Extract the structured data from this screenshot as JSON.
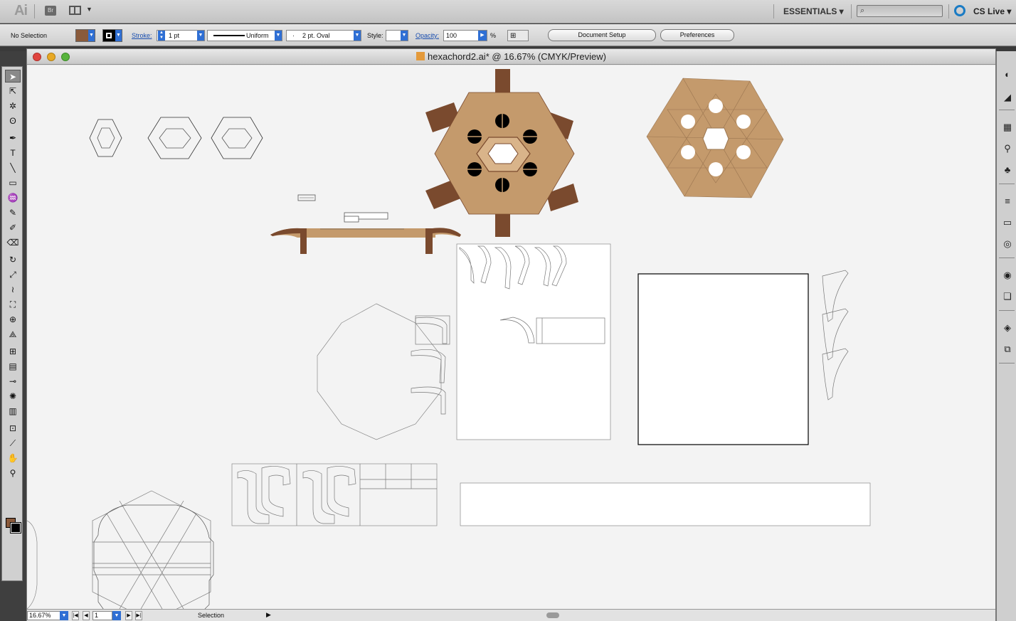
{
  "appbar": {
    "logo": "Ai",
    "bridge": "Br",
    "workspace": "ESSENTIALS ▾",
    "cslive": "CS Live ▾"
  },
  "control": {
    "selection": "No Selection",
    "fill_color": "#8a5a3b",
    "stroke_label": "Stroke:",
    "stroke_weight": "1 pt",
    "profile": "Uniform",
    "brush": "2 pt. Oval",
    "style_label": "Style:",
    "opacity_label": "Opacity:",
    "opacity_value": "100",
    "percent": "%",
    "document_setup": "Document Setup",
    "preferences": "Preferences"
  },
  "document": {
    "title": "hexachord2.ai* @ 16.67% (CMYK/Preview)"
  },
  "status": {
    "zoom": "16.67%",
    "artboard": "1",
    "tool": "Selection"
  },
  "colors": {
    "wood_light": "#c49a6c",
    "wood_dark": "#7a4a2e",
    "accent_blue": "#2f6fd4"
  },
  "tools": [
    "selection-tool-icon",
    "direct-selection-icon",
    "magic-wand-icon",
    "lasso-icon",
    "pen-icon",
    "type-icon",
    "line-icon",
    "rectangle-icon",
    "paintbrush-icon",
    "pencil-icon",
    "blob-brush-icon",
    "eraser-icon",
    "rotate-icon",
    "scale-icon",
    "warp-icon",
    "free-transform-icon",
    "shape-builder-icon",
    "perspective-icon",
    "mesh-icon",
    "gradient-icon",
    "eyedropper-icon",
    "symbol-sprayer-icon",
    "graph-icon",
    "artboard-icon",
    "slice-icon",
    "hand-icon",
    "zoom-icon"
  ]
}
